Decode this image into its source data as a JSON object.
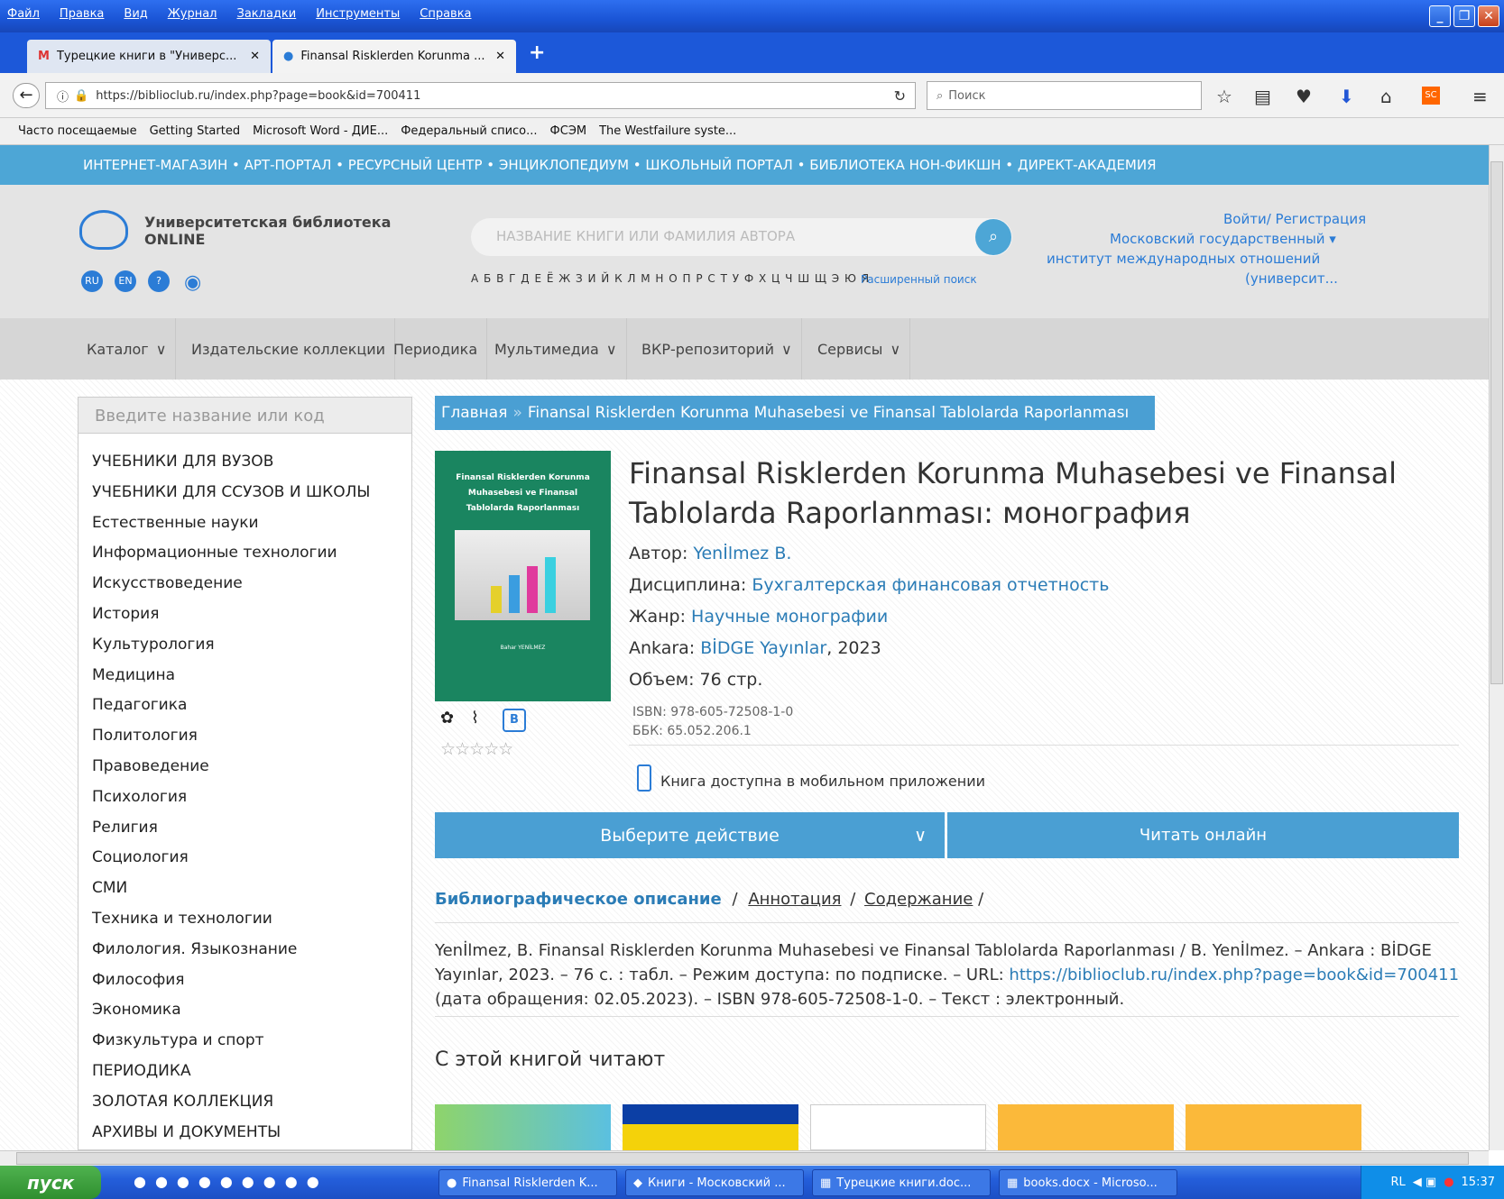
{
  "window": {
    "menu": [
      "Файл",
      "Правка",
      "Вид",
      "Журнал",
      "Закладки",
      "Инструменты",
      "Справка"
    ]
  },
  "tabs": [
    {
      "label": "Турецкие книги в \"Универс..."
    },
    {
      "label": "Finansal Risklerden Korunma ..."
    }
  ],
  "nav": {
    "url": "https://biblioclub.ru/index.php?page=book&id=700411",
    "search_placeholder": "Поиск"
  },
  "bookmarks": [
    "Часто посещаемые",
    "Getting Started",
    "Microsoft Word - ДИЕ...",
    "Федеральный списо...",
    "ФСЭМ",
    "The Westfailure syste..."
  ],
  "site": {
    "topnav": "ИНТЕРНЕТ-МАГАЗИН • АРТ-ПОРТАЛ • РЕСУРСНЫЙ ЦЕНТР • ЭНЦИКЛОПЕДИУМ • ШКОЛЬНЫЙ ПОРТАЛ • БИБЛИОТЕКА НОН-ФИКШН • ДИРЕКТ-АКАДЕМИЯ",
    "logo_line1": "Университетская библиотека",
    "logo_line2": "ONLINE",
    "lang": [
      "RU",
      "EN",
      "?"
    ],
    "search_placeholder": "НАЗВАНИЕ КНИГИ ИЛИ ФАМИЛИЯ АВТОРА",
    "alphabet": "А Б В Г Д Е Ё Ж З И Й К Л М Н О П Р С Т У Ф Х Ц Ч Ш Щ Э Ю Я",
    "advanced": "Расширенный поиск",
    "login": "Войти/ Регистрация",
    "org1": "Московский государственный ▾",
    "org2": "институт международных отношений",
    "org3": "(университ...",
    "menu": [
      "Каталог",
      "Издательские коллекции",
      "Периодика",
      "Мультимедиа",
      "ВКР-репозиторий",
      "Сервисы"
    ]
  },
  "sidebar": {
    "search_placeholder": "Введите название или код",
    "items": [
      "УЧЕБНИКИ ДЛЯ ВУЗОВ",
      "УЧЕБНИКИ ДЛЯ ССУЗОВ И ШКОЛЫ",
      "Естественные науки",
      "Информационные технологии",
      "Искусствоведение",
      "История",
      "Культурология",
      "Медицина",
      "Педагогика",
      "Политология",
      "Правоведение",
      "Психология",
      "Религия",
      "Социология",
      "СМИ",
      "Техника и технологии",
      "Филология. Языкознание",
      "Философия",
      "Экономика",
      "Физкультура и спорт",
      "ПЕРИОДИКА",
      "ЗОЛОТАЯ КОЛЛЕКЦИЯ",
      "АРХИВЫ И ДОКУМЕНТЫ"
    ]
  },
  "book": {
    "breadcrumb_home": "Главная",
    "breadcrumb_sep": "»",
    "breadcrumb_title": "Finansal Risklerden Korunma Muhasebesi ve Finansal Tablolarda Raporlanması",
    "cover_title": "Finansal Risklerden Korunma Muhasebesi ve Finansal Tablolarda Raporlanması",
    "cover_author": "Bahar YENİLMEZ",
    "title1": "Finansal Risklerden Korunma Muhasebesi ve Finansal",
    "title2": "Tablolarda Raporlanması: монография",
    "author_label": "Автор:",
    "author": "Yenİlmez B.",
    "disc_label": "Дисциплина:",
    "discipline": "Бухгалтерская финансовая отчетность",
    "genre_label": "Жанр:",
    "genre": "Научные монографии",
    "pub_label": "Ankara:",
    "publisher": "BİDGE Yayınlar",
    "year": ", 2023",
    "volume": "Объем: 76 стр.",
    "isbn": "ISBN: 978-605-72508-1-0",
    "bbk": "ББК: 65.052.206.1",
    "mobile": "Книга доступна в мобильном приложении",
    "btn_select": "Выберите действие",
    "btn_read": "Читать онлайн",
    "tab_biblio": "Библиографическое описание",
    "tab_annot": "Аннотация",
    "tab_content": "Содержание",
    "desc1": "Yenİlmez, B. Finansal Risklerden Korunma Muhasebesi ve Finansal Tablolarda Raporlanması / B. Yenİlmez. – Ankara : BİDGE",
    "desc2a": "Yayınlar, 2023. – 76 с. : табл. – Режим доступа: по подписке. – URL: ",
    "desc2_url": "https://biblioclub.ru/index.php?page=book&id=700411",
    "desc3": "(дата обращения: 02.05.2023). – ISBN 978-605-72508-1-0. – Текст : электронный.",
    "also": "С этой книгой читают"
  },
  "taskbar": {
    "start": "пуск",
    "tasks": [
      "Finansal Risklerden K...",
      "Книги - Московский ...",
      "Турецкие книги.doc...",
      "books.docx - Microso..."
    ],
    "lang": "RL",
    "time": "15:37"
  }
}
